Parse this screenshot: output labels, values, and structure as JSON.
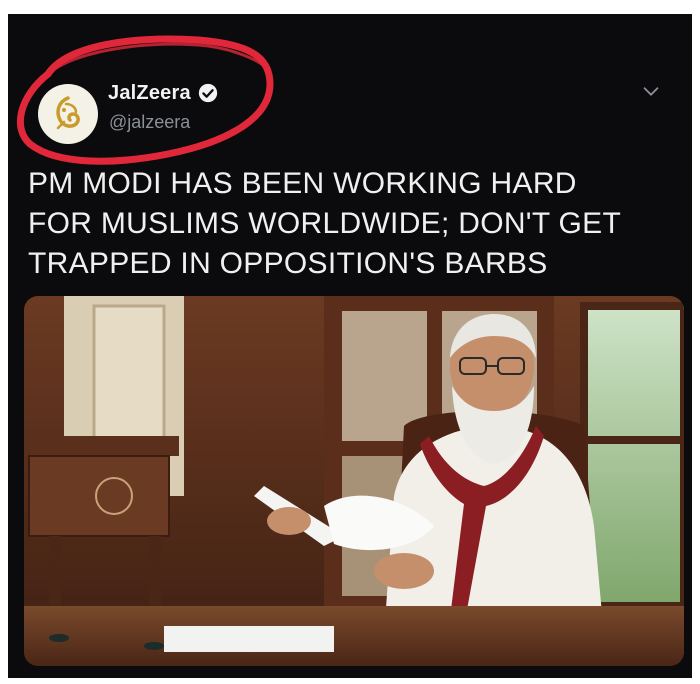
{
  "tweet": {
    "display_name": "JalZeera",
    "handle": "@jalzeera",
    "text": "PM MODI HAS BEEN WORKING HARD\nFOR MUSLIMS WORLDWIDE; DON'T GET\nTRAPPED IN OPPOSITION'S BARBS"
  },
  "icons": {
    "verified": "verified-badge-icon",
    "more": "chevron-down-icon",
    "avatar": "al-jazeera-logo"
  },
  "colors": {
    "background": "#0b0b0d",
    "text": "#f0f0f0",
    "handle": "#8b8f96",
    "annotation_circle": "#e0283a",
    "logo_gold": "#c89b2c"
  }
}
